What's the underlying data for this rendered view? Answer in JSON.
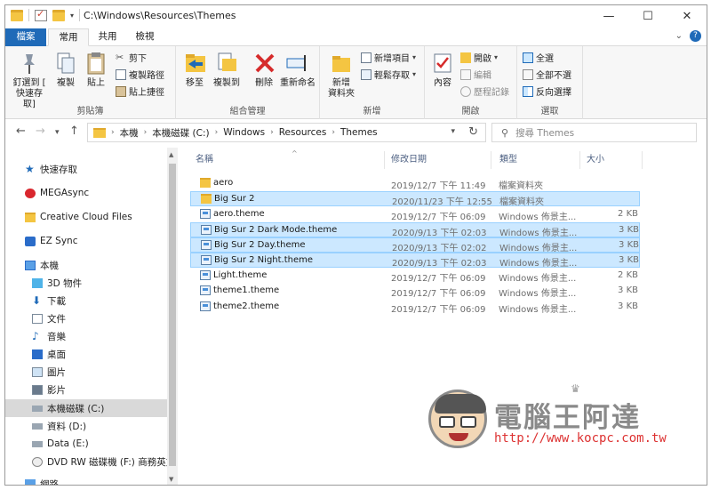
{
  "window": {
    "path_title": "C:\\Windows\\Resources\\Themes"
  },
  "ribbon_tabs": {
    "file": "檔案",
    "home": "常用",
    "share": "共用",
    "view": "檢視"
  },
  "ribbon": {
    "clipboard": {
      "pin": "釘選到 [\n快速存取]",
      "copy": "複製",
      "paste": "貼上",
      "cut": "剪下",
      "copy_path": "複製路徑",
      "paste_shortcut": "貼上捷徑",
      "label": "剪貼簿"
    },
    "organize": {
      "move_to": "移至",
      "copy_to": "複製到",
      "delete": "刪除",
      "rename": "重新命名",
      "label": "組合管理"
    },
    "new": {
      "new_folder": "新增\n資料夾",
      "new_item": "新增項目",
      "easy_access": "輕鬆存取",
      "label": "新增"
    },
    "open": {
      "properties": "內容",
      "open": "開啟",
      "edit": "編輯",
      "history": "歷程記錄",
      "label": "開啟"
    },
    "select": {
      "select_all": "全選",
      "select_none": "全部不選",
      "invert": "反向選擇",
      "label": "選取"
    }
  },
  "address": {
    "crumbs": [
      "本機",
      "本機磁碟 (C:)",
      "Windows",
      "Resources",
      "Themes"
    ],
    "search_placeholder": "搜尋 Themes"
  },
  "nav_pane": [
    {
      "label": "快速存取",
      "icon": "star-icon"
    },
    {
      "label": "MEGAsync",
      "icon": "mega-icon"
    },
    {
      "label": "Creative Cloud Files",
      "icon": "creative-cloud-icon"
    },
    {
      "label": "EZ Sync",
      "icon": "ez-sync-icon"
    },
    {
      "label": "本機",
      "icon": "computer-icon"
    },
    {
      "label": "3D 物件",
      "icon": "3d-objects-icon"
    },
    {
      "label": "下載",
      "icon": "download-icon"
    },
    {
      "label": "文件",
      "icon": "document-icon"
    },
    {
      "label": "音樂",
      "icon": "music-icon"
    },
    {
      "label": "桌面",
      "icon": "desktop-icon"
    },
    {
      "label": "圖片",
      "icon": "pictures-icon"
    },
    {
      "label": "影片",
      "icon": "video-icon"
    },
    {
      "label": "本機磁碟 (C:)",
      "icon": "drive-icon"
    },
    {
      "label": "資料 (D:)",
      "icon": "drive-icon"
    },
    {
      "label": "Data (E:)",
      "icon": "drive-icon"
    },
    {
      "label": "DVD RW 磁碟機 (F:) 商務英文",
      "icon": "dvd-icon"
    },
    {
      "label": "網路",
      "icon": "network-icon"
    }
  ],
  "columns": {
    "name": "名稱",
    "date": "修改日期",
    "type": "類型",
    "size": "大小"
  },
  "files": [
    {
      "name": "aero",
      "date": "2019/12/7 下午 11:49",
      "type": "檔案資料夾",
      "size": "",
      "kind": "folder",
      "selected": false
    },
    {
      "name": "Big Sur 2",
      "date": "2020/11/23 下午 12:55",
      "type": "檔案資料夾",
      "size": "",
      "kind": "folder",
      "selected": true
    },
    {
      "name": "aero.theme",
      "date": "2019/12/7 下午 06:09",
      "type": "Windows 佈景主...",
      "size": "2 KB",
      "kind": "theme",
      "selected": false
    },
    {
      "name": "Big Sur 2 Dark Mode.theme",
      "date": "2020/9/13 下午 02:03",
      "type": "Windows 佈景主...",
      "size": "3 KB",
      "kind": "theme",
      "selected": true
    },
    {
      "name": "Big Sur 2 Day.theme",
      "date": "2020/9/13 下午 02:02",
      "type": "Windows 佈景主...",
      "size": "3 KB",
      "kind": "theme",
      "selected": true
    },
    {
      "name": "Big Sur 2 Night.theme",
      "date": "2020/9/13 下午 02:03",
      "type": "Windows 佈景主...",
      "size": "3 KB",
      "kind": "theme",
      "selected": true
    },
    {
      "name": "Light.theme",
      "date": "2019/12/7 下午 06:09",
      "type": "Windows 佈景主...",
      "size": "2 KB",
      "kind": "theme",
      "selected": false
    },
    {
      "name": "theme1.theme",
      "date": "2019/12/7 下午 06:09",
      "type": "Windows 佈景主...",
      "size": "3 KB",
      "kind": "theme",
      "selected": false
    },
    {
      "name": "theme2.theme",
      "date": "2019/12/7 下午 06:09",
      "type": "Windows 佈景主...",
      "size": "3 KB",
      "kind": "theme",
      "selected": false
    }
  ],
  "watermark": {
    "title": "電腦王阿達",
    "url": "http://www.kocpc.com.tw"
  },
  "colors": {
    "accent": "#1f6ab8",
    "selection": "#cce8ff",
    "folder": "#f4c542"
  }
}
